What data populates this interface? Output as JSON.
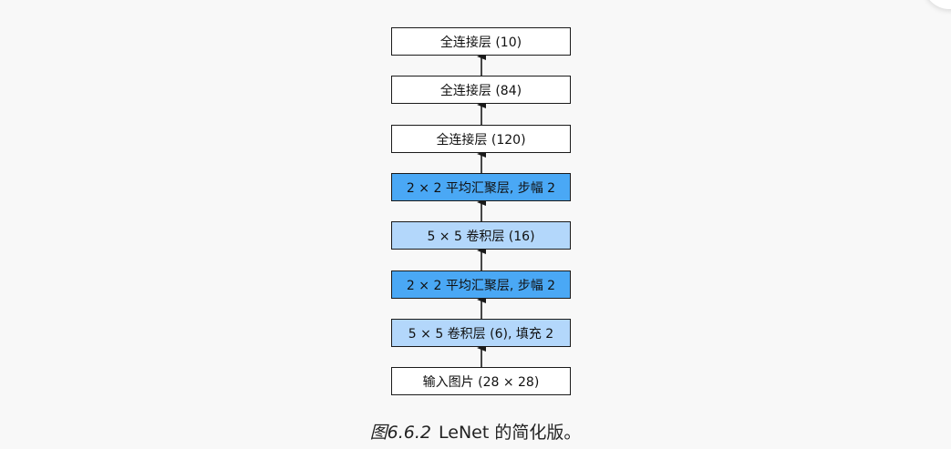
{
  "diagram": {
    "layers": [
      {
        "label": "全连接层 (10)",
        "kind": "fc"
      },
      {
        "label": "全连接层 (84)",
        "kind": "fc"
      },
      {
        "label": "全连接层 (120)",
        "kind": "fc"
      },
      {
        "label": "2 × 2 平均汇聚层, 步幅 2",
        "kind": "pool"
      },
      {
        "label": "5 × 5 卷积层 (16)",
        "kind": "conv"
      },
      {
        "label": "2 × 2 平均汇聚层, 步幅 2",
        "kind": "pool"
      },
      {
        "label": "5 × 5 卷积层 (6), 填充 2",
        "kind": "conv"
      },
      {
        "label": "输入图片 (28 × 28)",
        "kind": "input"
      }
    ],
    "colors": {
      "pool": "#4aa8f5",
      "conv": "#b3d7fb",
      "fc": "#ffffff",
      "input": "#ffffff",
      "border": "#1a1a1a"
    }
  },
  "caption": {
    "figure_label": "图6.6.2",
    "text": "LeNet 的简化版。"
  }
}
